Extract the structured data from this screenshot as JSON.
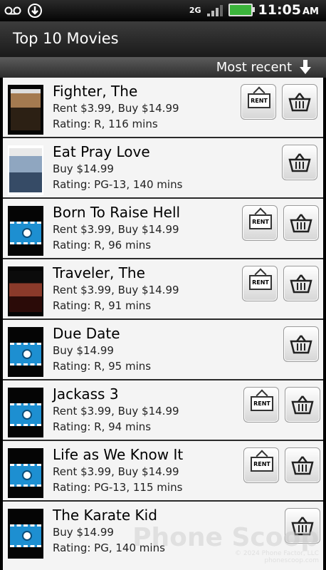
{
  "status_bar": {
    "time": "11:05",
    "ampm": "AM",
    "network": "2G",
    "icons": [
      "voicemail-icon",
      "download-icon",
      "signal-icon",
      "battery-icon"
    ]
  },
  "header": {
    "title": "Top 10 Movies"
  },
  "sort": {
    "label": "Most recent"
  },
  "buttons": {
    "rent_label": "RENT"
  },
  "movies": [
    {
      "title": "Fighter, The",
      "price": "Rent $3.99, Buy $14.99",
      "rating": "Rating: R, 116 mins",
      "rentable": true
    },
    {
      "title": "Eat Pray Love",
      "price": "Buy $14.99",
      "rating": "Rating: PG-13, 140 mins",
      "rentable": false
    },
    {
      "title": "Born To Raise Hell",
      "price": "Rent $3.99, Buy $14.99",
      "rating": "Rating: R, 96 mins",
      "rentable": true
    },
    {
      "title": "Traveler, The",
      "price": "Rent $3.99, Buy $14.99",
      "rating": "Rating: R, 91 mins",
      "rentable": true
    },
    {
      "title": "Due Date",
      "price": "Buy $14.99",
      "rating": "Rating: R, 95 mins",
      "rentable": false
    },
    {
      "title": "Jackass 3",
      "price": "Rent $3.99, Buy $14.99",
      "rating": "Rating: R, 94 mins",
      "rentable": true
    },
    {
      "title": "Life as We Know It",
      "price": "Rent $3.99, Buy $14.99",
      "rating": "Rating: PG-13, 115 mins",
      "rentable": true
    },
    {
      "title": "The Karate Kid",
      "price": "Buy $14.99",
      "rating": "Rating: PG, 140 mins",
      "rentable": false
    }
  ],
  "watermark": {
    "text": "Phone Scoop",
    "small": "© 2024 Phone Factor, LLC",
    "url": "phonescoop.com"
  }
}
